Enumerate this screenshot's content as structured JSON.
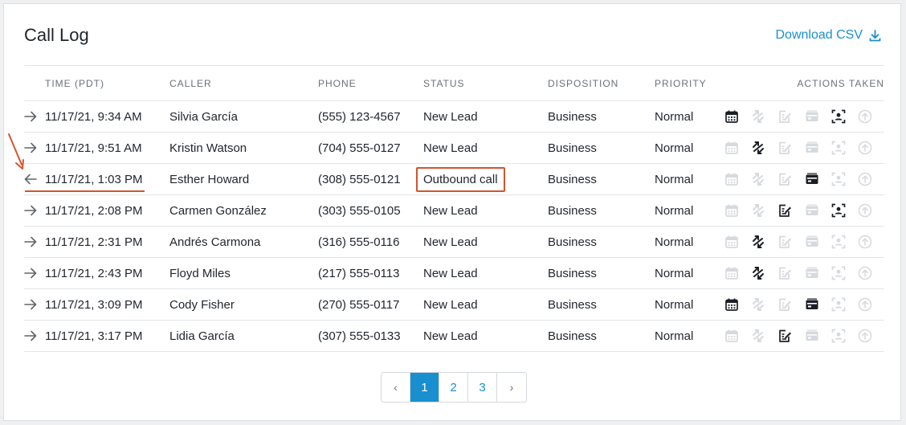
{
  "header": {
    "title": "Call Log",
    "download_label": "Download CSV"
  },
  "columns": [
    "TIME (PDT)",
    "CALLER",
    "PHONE",
    "STATUS",
    "DISPOSITION",
    "PRIORITY",
    "ACTIONS TAKEN"
  ],
  "rows": [
    {
      "direction": "inbound",
      "time": "11/17/21, 9:34 AM",
      "caller": "Silvia García",
      "phone": "(555) 123-4567",
      "status": "New Lead",
      "disposition": "Business",
      "priority": "Normal",
      "actions": {
        "calendar": true,
        "transfer": false,
        "note": false,
        "card": false,
        "contact": true,
        "upload": false
      }
    },
    {
      "direction": "inbound",
      "time": "11/17/21, 9:51 AM",
      "caller": "Kristin Watson",
      "phone": "(704) 555-0127",
      "status": "New Lead",
      "disposition": "Business",
      "priority": "Normal",
      "actions": {
        "calendar": false,
        "transfer": true,
        "note": false,
        "card": false,
        "contact": false,
        "upload": false
      }
    },
    {
      "direction": "outbound",
      "time": "11/17/21, 1:03 PM",
      "caller": "Esther Howard",
      "phone": "(308) 555-0121",
      "status": "Outbound call",
      "disposition": "Business",
      "priority": "Normal",
      "actions": {
        "calendar": false,
        "transfer": false,
        "note": false,
        "card": true,
        "contact": false,
        "upload": false
      },
      "highlighted": true
    },
    {
      "direction": "inbound",
      "time": "11/17/21, 2:08 PM",
      "caller": "Carmen González",
      "phone": "(303) 555-0105",
      "status": "New Lead",
      "disposition": "Business",
      "priority": "Normal",
      "actions": {
        "calendar": false,
        "transfer": false,
        "note": true,
        "card": false,
        "contact": true,
        "upload": false
      }
    },
    {
      "direction": "inbound",
      "time": "11/17/21, 2:31 PM",
      "caller": "Andrés Carmona",
      "phone": "(316) 555-0116",
      "status": "New Lead",
      "disposition": "Business",
      "priority": "Normal",
      "actions": {
        "calendar": false,
        "transfer": true,
        "note": false,
        "card": false,
        "contact": false,
        "upload": false
      }
    },
    {
      "direction": "inbound",
      "time": "11/17/21, 2:43 PM",
      "caller": "Floyd Miles",
      "phone": "(217) 555-0113",
      "status": "New Lead",
      "disposition": "Business",
      "priority": "Normal",
      "actions": {
        "calendar": false,
        "transfer": true,
        "note": false,
        "card": false,
        "contact": false,
        "upload": false
      }
    },
    {
      "direction": "inbound",
      "time": "11/17/21, 3:09 PM",
      "caller": "Cody Fisher",
      "phone": "(270) 555-0117",
      "status": "New Lead",
      "disposition": "Business",
      "priority": "Normal",
      "actions": {
        "calendar": true,
        "transfer": false,
        "note": false,
        "card": true,
        "contact": false,
        "upload": false
      }
    },
    {
      "direction": "inbound",
      "time": "11/17/21, 3:17 PM",
      "caller": "Lidia García",
      "phone": "(307) 555-0133",
      "status": "New Lead",
      "disposition": "Business",
      "priority": "Normal",
      "actions": {
        "calendar": false,
        "transfer": false,
        "note": true,
        "card": false,
        "contact": false,
        "upload": false
      }
    }
  ],
  "action_icons": [
    "calendar-icon",
    "transfer-icon",
    "note-icon",
    "card-icon",
    "contact-icon",
    "upload-icon"
  ],
  "pagination": {
    "prev": "‹",
    "pages": [
      "1",
      "2",
      "3"
    ],
    "current": "1",
    "next": "›"
  },
  "colors": {
    "accent": "#1a8fd0",
    "annotation": "#d2552d",
    "icon_active": "#1b1f24",
    "icon_inactive": "#d6d9dd"
  }
}
